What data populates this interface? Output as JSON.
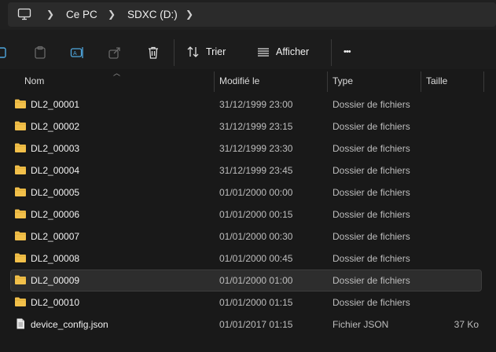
{
  "address": {
    "icon": "monitor-icon",
    "crumbs": [
      "Ce PC",
      "SDXC (D:)"
    ]
  },
  "toolbar": {
    "icons": [
      "copy-icon",
      "paste-icon",
      "rename-icon",
      "share-icon",
      "delete-icon"
    ],
    "sort_label": "Trier",
    "view_label": "Afficher",
    "more_label": "•••"
  },
  "columns": {
    "name": "Nom",
    "modified": "Modifié le",
    "type": "Type",
    "size": "Taille"
  },
  "files": [
    {
      "name": "DL2_00001",
      "modified": "31/12/1999 23:00",
      "type": "Dossier de fichiers",
      "size": "",
      "icon": "folder-icon",
      "selected": false
    },
    {
      "name": "DL2_00002",
      "modified": "31/12/1999 23:15",
      "type": "Dossier de fichiers",
      "size": "",
      "icon": "folder-icon",
      "selected": false
    },
    {
      "name": "DL2_00003",
      "modified": "31/12/1999 23:30",
      "type": "Dossier de fichiers",
      "size": "",
      "icon": "folder-icon",
      "selected": false
    },
    {
      "name": "DL2_00004",
      "modified": "31/12/1999 23:45",
      "type": "Dossier de fichiers",
      "size": "",
      "icon": "folder-icon",
      "selected": false
    },
    {
      "name": "DL2_00005",
      "modified": "01/01/2000 00:00",
      "type": "Dossier de fichiers",
      "size": "",
      "icon": "folder-icon",
      "selected": false
    },
    {
      "name": "DL2_00006",
      "modified": "01/01/2000 00:15",
      "type": "Dossier de fichiers",
      "size": "",
      "icon": "folder-icon",
      "selected": false
    },
    {
      "name": "DL2_00007",
      "modified": "01/01/2000 00:30",
      "type": "Dossier de fichiers",
      "size": "",
      "icon": "folder-icon",
      "selected": false
    },
    {
      "name": "DL2_00008",
      "modified": "01/01/2000 00:45",
      "type": "Dossier de fichiers",
      "size": "",
      "icon": "folder-icon",
      "selected": false
    },
    {
      "name": "DL2_00009",
      "modified": "01/01/2000 01:00",
      "type": "Dossier de fichiers",
      "size": "",
      "icon": "folder-icon",
      "selected": true
    },
    {
      "name": "DL2_00010",
      "modified": "01/01/2000 01:15",
      "type": "Dossier de fichiers",
      "size": "",
      "icon": "folder-icon",
      "selected": false
    },
    {
      "name": "device_config.json",
      "modified": "01/01/2017 01:15",
      "type": "Fichier JSON",
      "size": "37 Ko",
      "icon": "json-file-icon",
      "selected": false
    }
  ],
  "colors": {
    "folder": "#f2c04a",
    "selected_row": "#2d2d2d",
    "background": "#191919"
  }
}
